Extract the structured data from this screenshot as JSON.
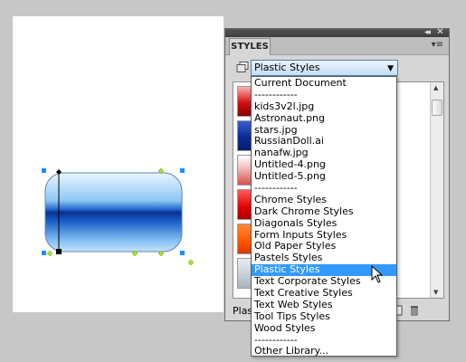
{
  "panel": {
    "title_tab": "STYLES",
    "collapse_glyph": "◂◂",
    "close_glyph": "✕",
    "menu_glyph": "▾≡",
    "dropdown_selected": "Plastic Styles",
    "dropdown_arrow": "▼",
    "footer_text": "Plast"
  },
  "dropdown_options": [
    "Current Document",
    "------------",
    "kids3v2l.jpg",
    "Astronaut.png",
    "stars.jpg",
    "RussianDoll.ai",
    "nanafw.jpg",
    "Untitled-4.png",
    "Untitled-5.png",
    "------------",
    "Chrome Styles",
    "Dark Chrome Styles",
    "Diagonals Styles",
    "Form Inputs Styles",
    "Old Paper Styles",
    "Pastels Styles",
    "Plastic Styles",
    "Text Corporate Styles",
    "Text Creative Styles",
    "Text Web Styles",
    "Tool Tips Styles",
    "Wood Styles",
    "------------",
    "Other Library..."
  ],
  "selected_index": 16,
  "colors": {
    "selection": "#3399ff",
    "canvas_bg": "#ffffff",
    "workspace_bg": "#c7c7c7",
    "handle_blue": "#1e90ff",
    "handle_green": "#a6e22e"
  },
  "icons": [
    "library-icon",
    "close-icon",
    "collapse-icon",
    "panel-menu-icon",
    "dropdown-arrow-icon",
    "scroll-up-icon",
    "scroll-down-icon",
    "new-style-icon",
    "delete-style-icon",
    "mouse-cursor-icon"
  ]
}
